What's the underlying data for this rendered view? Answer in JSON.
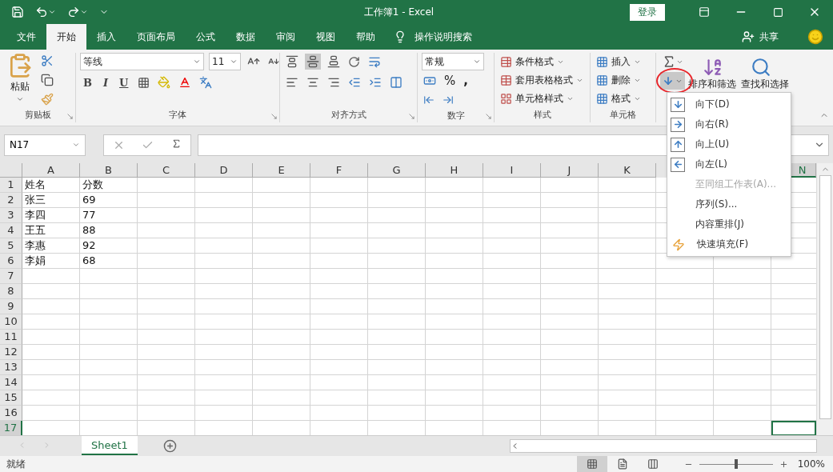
{
  "window": {
    "title": "工作簿1  -  Excel",
    "login": "登录"
  },
  "ribbon_tabs": [
    {
      "label": "文件",
      "selected": false
    },
    {
      "label": "开始",
      "selected": true
    },
    {
      "label": "插入",
      "selected": false
    },
    {
      "label": "页面布局",
      "selected": false
    },
    {
      "label": "公式",
      "selected": false
    },
    {
      "label": "数据",
      "selected": false
    },
    {
      "label": "审阅",
      "selected": false
    },
    {
      "label": "视图",
      "selected": false
    },
    {
      "label": "帮助",
      "selected": false
    }
  ],
  "tell_me": "操作说明搜索",
  "share": "共享",
  "ribbon": {
    "clipboard": {
      "paste": "粘贴",
      "label": "剪贴板"
    },
    "font": {
      "name": "等线",
      "size": "11",
      "bold": "B",
      "italic": "I",
      "underline": "U",
      "label": "字体"
    },
    "alignment": {
      "label": "对齐方式",
      "vertical": [
        {
          "selected": false
        },
        {
          "selected": true
        },
        {
          "selected": false
        }
      ]
    },
    "number": {
      "format": "常规",
      "percent": "%",
      "comma": ",",
      "label": "数字"
    },
    "styles": {
      "items": [
        "条件格式",
        "套用表格格式",
        "单元格样式"
      ],
      "label": "样式"
    },
    "cells": {
      "items": [
        "插入",
        "删除",
        "格式"
      ],
      "label": "单元格"
    },
    "editing": {
      "fill_expanded": true,
      "sort": "排序和筛选",
      "find": "查找和选择"
    }
  },
  "fill_menu": {
    "items": [
      {
        "label": "向下(D)",
        "kind": "down",
        "disabled": false
      },
      {
        "label": "向右(R)",
        "kind": "right",
        "disabled": false
      },
      {
        "label": "向上(U)",
        "kind": "up",
        "disabled": false
      },
      {
        "label": "向左(L)",
        "kind": "left",
        "disabled": false
      },
      {
        "label": "至同组工作表(A)...",
        "kind": "plain",
        "disabled": true
      },
      {
        "label": "序列(S)...",
        "kind": "plain",
        "disabled": false
      },
      {
        "label": "内容重排(J)",
        "kind": "plain",
        "disabled": false
      },
      {
        "label": "快速填充(F)",
        "kind": "flash",
        "disabled": false
      }
    ]
  },
  "formula_bar": {
    "name_box": "N17"
  },
  "sheet": {
    "columns": [
      {
        "label": "A",
        "selected": false
      },
      {
        "label": "B",
        "selected": false
      },
      {
        "label": "C",
        "selected": false
      },
      {
        "label": "D",
        "selected": false
      },
      {
        "label": "E",
        "selected": false
      },
      {
        "label": "F",
        "selected": false
      },
      {
        "label": "G",
        "selected": false
      },
      {
        "label": "H",
        "selected": false
      },
      {
        "label": "I",
        "selected": false
      },
      {
        "label": "J",
        "selected": false
      },
      {
        "label": "K",
        "selected": false
      },
      {
        "label": "N",
        "selected": true
      }
    ],
    "rows": [
      {
        "number": "1",
        "selected": false,
        "cells": [
          "姓名",
          "分数"
        ]
      },
      {
        "number": "2",
        "selected": false,
        "cells": [
          "张三",
          "69"
        ]
      },
      {
        "number": "3",
        "selected": false,
        "cells": [
          "李四",
          "77"
        ]
      },
      {
        "number": "4",
        "selected": false,
        "cells": [
          "王五",
          "88"
        ]
      },
      {
        "number": "5",
        "selected": false,
        "cells": [
          "李惠",
          "92"
        ]
      },
      {
        "number": "6",
        "selected": false,
        "cells": [
          "李娟",
          "68"
        ]
      },
      {
        "number": "7",
        "selected": false,
        "cells": []
      },
      {
        "number": "8",
        "selected": false,
        "cells": []
      },
      {
        "number": "9",
        "selected": false,
        "cells": []
      },
      {
        "number": "10",
        "selected": false,
        "cells": []
      },
      {
        "number": "11",
        "selected": false,
        "cells": []
      },
      {
        "number": "12",
        "selected": false,
        "cells": []
      },
      {
        "number": "13",
        "selected": false,
        "cells": []
      },
      {
        "number": "14",
        "selected": false,
        "cells": []
      },
      {
        "number": "15",
        "selected": false,
        "cells": []
      },
      {
        "number": "16",
        "selected": false,
        "cells": []
      },
      {
        "number": "17",
        "selected": true,
        "cells": []
      }
    ]
  },
  "sheet_tabs": [
    {
      "label": "Sheet1",
      "selected": true
    }
  ],
  "status_bar": {
    "status": "就绪",
    "views": [
      {
        "kind": "normal",
        "selected": true
      },
      {
        "kind": "layout",
        "selected": false
      },
      {
        "kind": "break",
        "selected": false
      }
    ],
    "zoom": {
      "level": 0.5,
      "reading": "100%"
    }
  }
}
